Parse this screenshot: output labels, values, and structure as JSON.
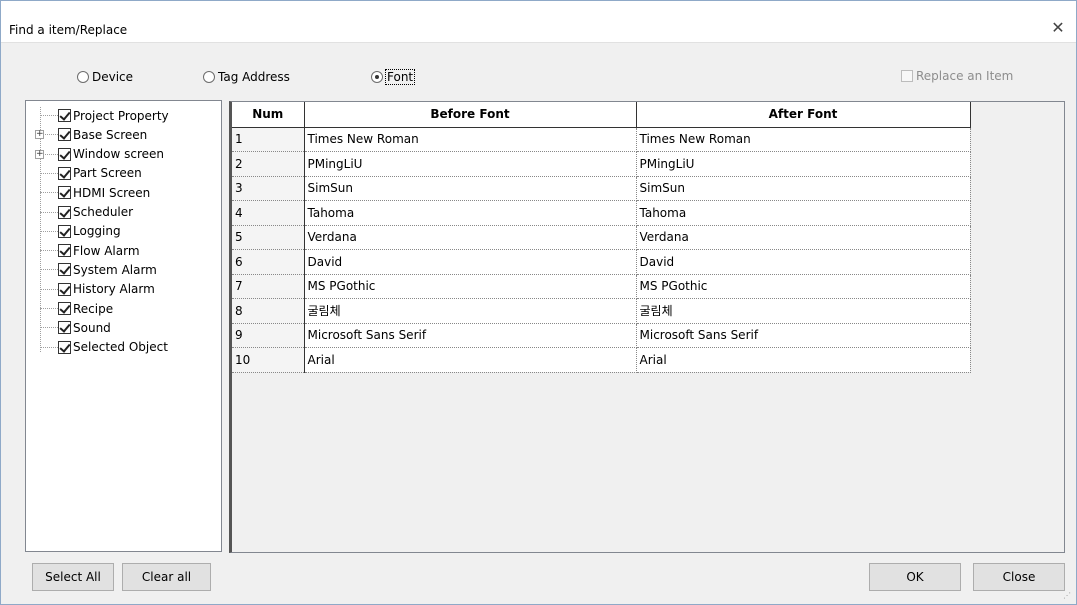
{
  "dialog": {
    "title": "Find a item/Replace",
    "close_glyph": "✕"
  },
  "options": {
    "radios": [
      {
        "label": "Device",
        "checked": false
      },
      {
        "label": "Tag Address",
        "checked": false
      },
      {
        "label": "Font",
        "checked": true
      }
    ],
    "replace_item_label": "Replace an Item"
  },
  "tree": {
    "items": [
      {
        "label": "Project Property",
        "expandable": false,
        "checked": true
      },
      {
        "label": "Base Screen",
        "expandable": true,
        "checked": true
      },
      {
        "label": "Window screen",
        "expandable": true,
        "checked": true
      },
      {
        "label": "Part Screen",
        "expandable": false,
        "checked": true
      },
      {
        "label": "HDMI Screen",
        "expandable": false,
        "checked": true
      },
      {
        "label": "Scheduler",
        "expandable": false,
        "checked": true
      },
      {
        "label": "Logging",
        "expandable": false,
        "checked": true
      },
      {
        "label": "Flow Alarm",
        "expandable": false,
        "checked": true
      },
      {
        "label": "System Alarm",
        "expandable": false,
        "checked": true
      },
      {
        "label": "History Alarm",
        "expandable": false,
        "checked": true
      },
      {
        "label": "Recipe",
        "expandable": false,
        "checked": true
      },
      {
        "label": "Sound",
        "expandable": false,
        "checked": true
      },
      {
        "label": "Selected Object",
        "expandable": false,
        "checked": true
      }
    ]
  },
  "grid": {
    "headers": {
      "num": "Num",
      "before": "Before Font",
      "after": "After Font"
    },
    "rows": [
      {
        "num": "1",
        "before": "Times New Roman",
        "after": "Times New Roman"
      },
      {
        "num": "2",
        "before": "PMingLiU",
        "after": "PMingLiU"
      },
      {
        "num": "3",
        "before": "SimSun",
        "after": "SimSun"
      },
      {
        "num": "4",
        "before": "Tahoma",
        "after": "Tahoma"
      },
      {
        "num": "5",
        "before": "Verdana",
        "after": "Verdana"
      },
      {
        "num": "6",
        "before": "David",
        "after": "David"
      },
      {
        "num": "7",
        "before": "MS PGothic",
        "after": "MS PGothic"
      },
      {
        "num": "8",
        "before": "굴림체",
        "after": "굴림체"
      },
      {
        "num": "9",
        "before": "Microsoft Sans Serif",
        "after": "Microsoft Sans Serif"
      },
      {
        "num": "10",
        "before": "Arial",
        "after": "Arial"
      }
    ]
  },
  "buttons": {
    "select_all": "Select All",
    "clear_all": "Clear all",
    "ok": "OK",
    "close": "Close"
  }
}
